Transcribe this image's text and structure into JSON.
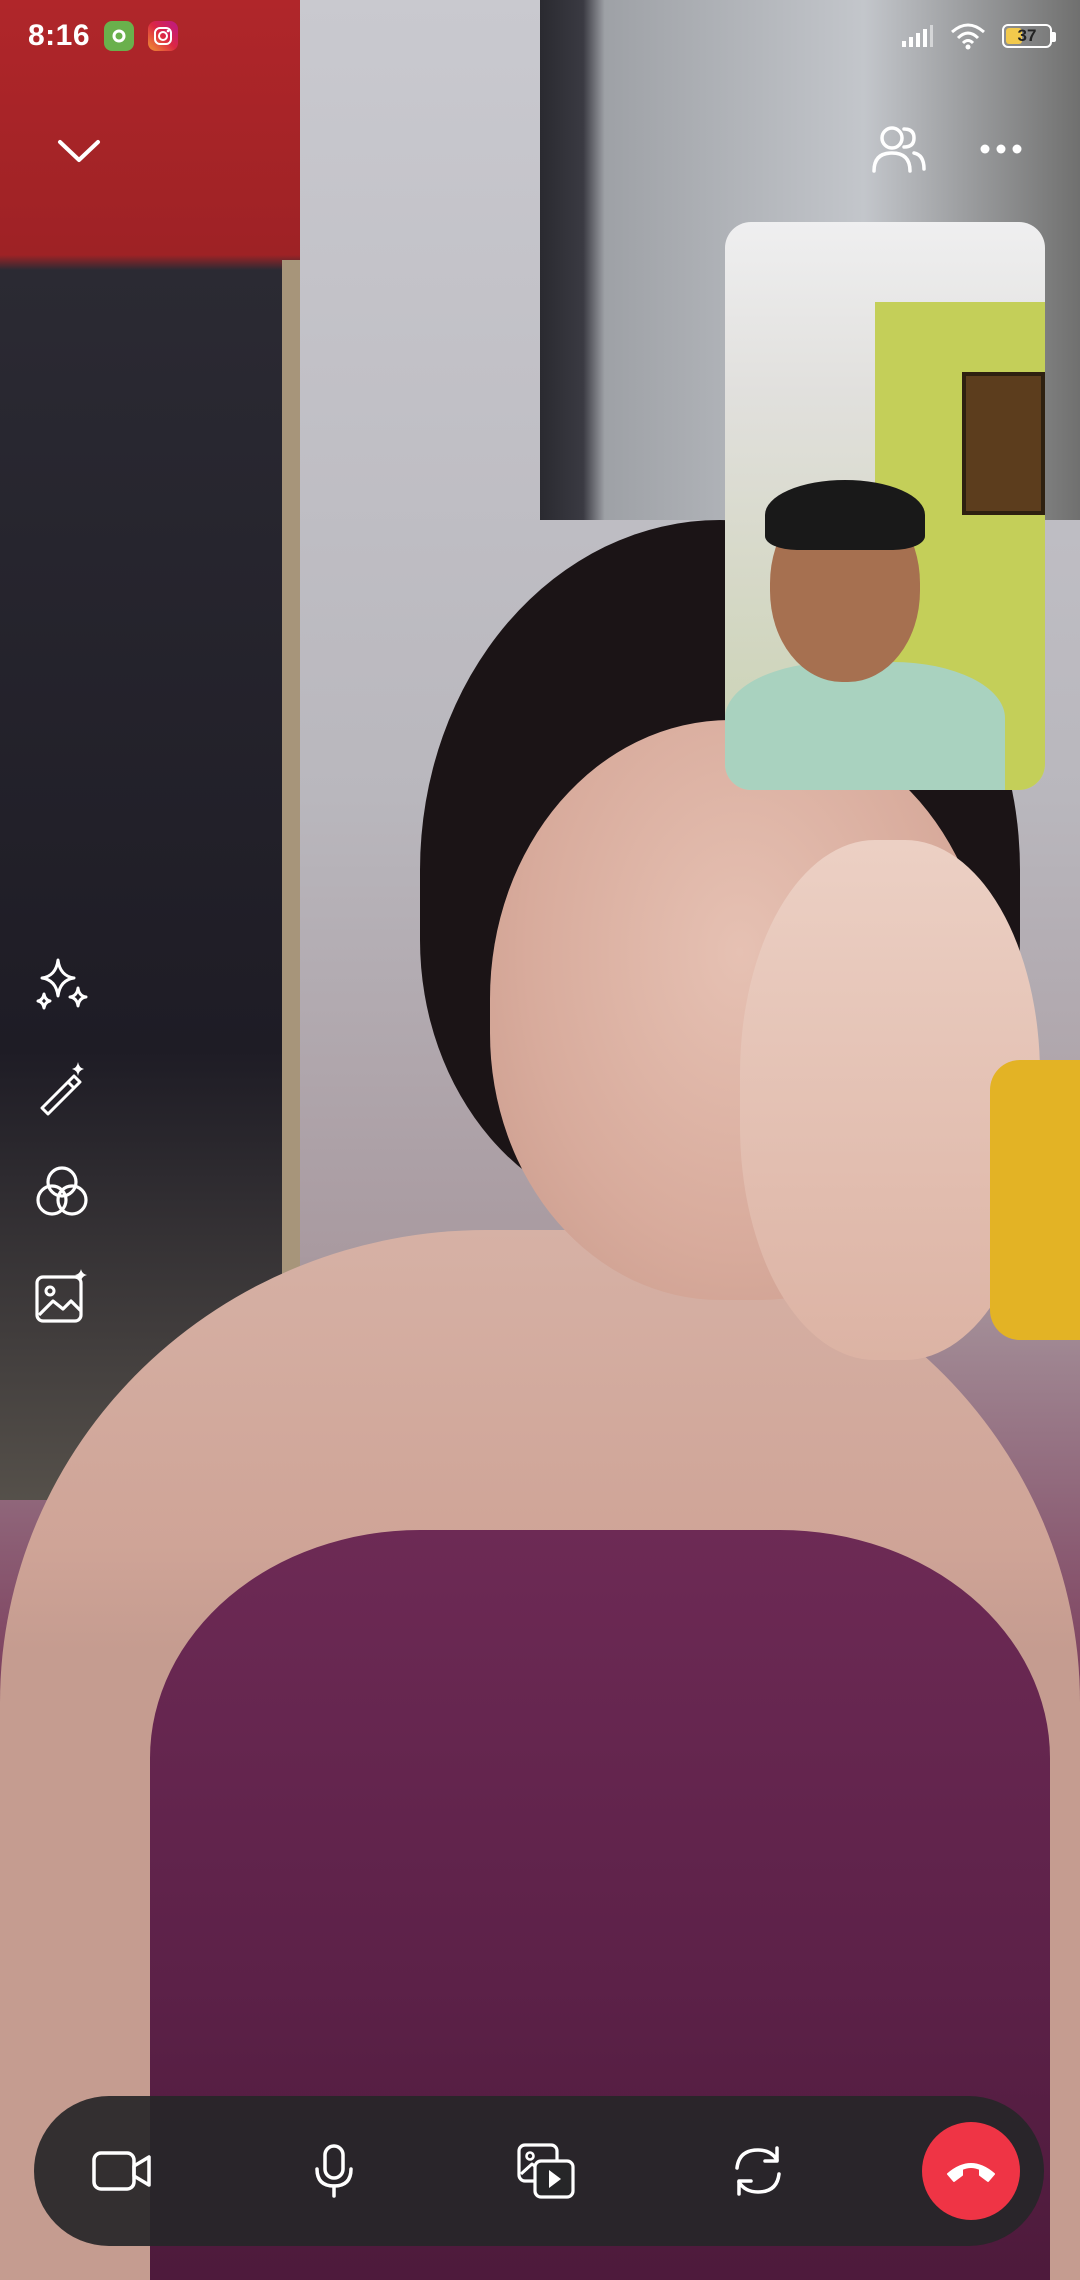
{
  "status_bar": {
    "time": "8:16",
    "battery_level": "37",
    "battery_fraction": 0.37,
    "notification_icons": [
      "settings-app-icon",
      "instagram-icon"
    ],
    "system_icons": [
      "signal-icon",
      "wifi-icon",
      "battery-icon"
    ]
  },
  "top_bar": {
    "icons": [
      "chevron-down-icon",
      "participants-icon",
      "more-options-icon"
    ]
  },
  "effects_toolbar": {
    "items": [
      "sparkles-icon",
      "magic-wand-icon",
      "filters-icon",
      "background-image-icon"
    ]
  },
  "call_controls": {
    "items": [
      "video-camera-icon",
      "microphone-icon",
      "share-media-icon",
      "flip-camera-icon",
      "end-call-icon"
    ]
  },
  "colors": {
    "end_call": "#ef3445",
    "controls_background": "#262628",
    "icon_color": "#ffffff"
  }
}
